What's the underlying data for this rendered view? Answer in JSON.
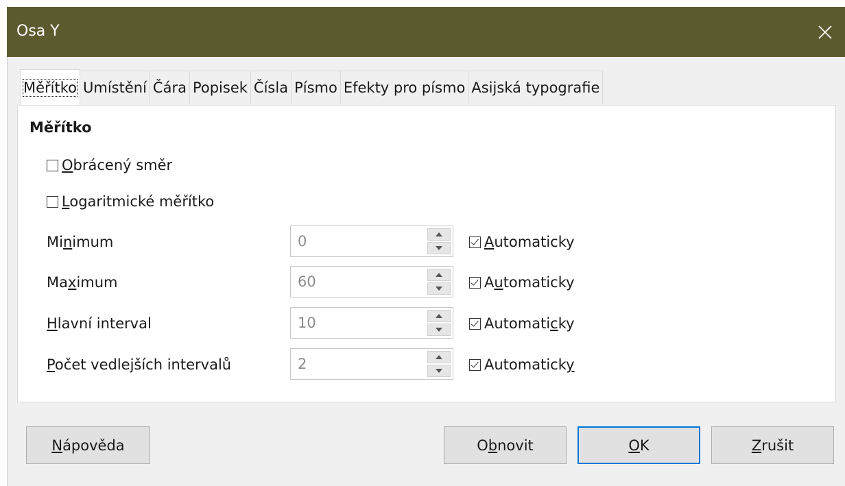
{
  "window": {
    "title": "Osa Y",
    "close_icon": "close-icon"
  },
  "tabs": [
    {
      "label": "Měřítko",
      "active": true
    },
    {
      "label": "Umístění"
    },
    {
      "label": "Čára"
    },
    {
      "label": "Popisek"
    },
    {
      "label": "Čísla"
    },
    {
      "label": "Písmo"
    },
    {
      "label": "Efekty pro písmo"
    },
    {
      "label": "Asijská typografie"
    }
  ],
  "scale": {
    "heading": "Měřítko",
    "reverse_direction": {
      "label_u": "O",
      "label_rest": "brácený směr",
      "checked": false
    },
    "logarithmic": {
      "label_u": "L",
      "label_rest": "ogaritmické měřítko",
      "checked": false
    },
    "fields": [
      {
        "label_pre": "Mi",
        "label_u": "n",
        "label_post": "imum",
        "value": "0",
        "auto_pre": "",
        "auto_u": "A",
        "auto_post": "utomaticky",
        "auto_checked": true
      },
      {
        "label_pre": "Ma",
        "label_u": "x",
        "label_post": "imum",
        "value": "60",
        "auto_pre": "A",
        "auto_u": "u",
        "auto_post": "tomaticky",
        "auto_checked": true
      },
      {
        "label_pre": "",
        "label_u": "H",
        "label_post": "lavní interval",
        "value": "10",
        "auto_pre": "Automati",
        "auto_u": "c",
        "auto_post": "ky",
        "auto_checked": true
      },
      {
        "label_pre": "",
        "label_u": "P",
        "label_post": "očet vedlejších intervalů",
        "value": "2",
        "auto_pre": "Automatick",
        "auto_u": "y",
        "auto_post": "",
        "auto_checked": true
      }
    ]
  },
  "buttons": {
    "help": {
      "u": "N",
      "rest": "ápověda"
    },
    "reset": {
      "pre": "O",
      "u": "b",
      "post": "novit"
    },
    "ok": {
      "u": "O",
      "rest": "K"
    },
    "cancel": {
      "u": "Z",
      "rest": "rušit"
    }
  }
}
